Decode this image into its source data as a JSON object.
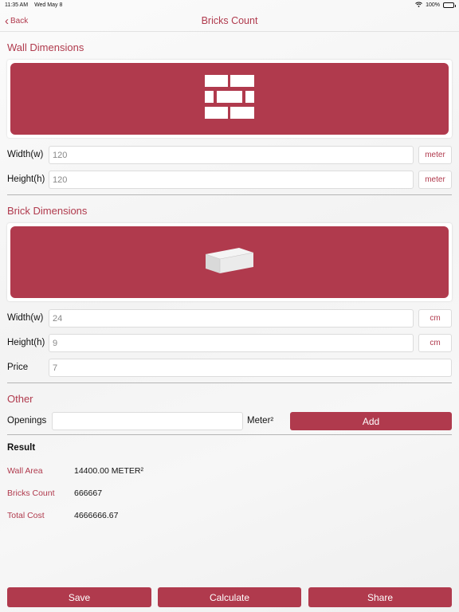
{
  "status": {
    "time": "11:35 AM",
    "date": "Wed May 8",
    "battery": "100%"
  },
  "nav": {
    "back_label": "Back",
    "title": "Bricks Count"
  },
  "wall": {
    "section_title": "Wall Dimensions",
    "width_label": "Width(w)",
    "width_value": "120",
    "width_unit": "meter",
    "height_label": "Height(h)",
    "height_value": "120",
    "height_unit": "meter"
  },
  "brick": {
    "section_title": "Brick Dimensions",
    "width_label": "Width(w)",
    "width_value": "24",
    "width_unit": "cm",
    "height_label": "Height(h)",
    "height_value": "9",
    "height_unit": "cm",
    "price_label": "Price",
    "price_value": "7"
  },
  "other": {
    "section_title": "Other",
    "openings_label": "Openings",
    "openings_value": "",
    "openings_unit": "Meter²",
    "add_label": "Add"
  },
  "result": {
    "title": "Result",
    "wall_area_label": "Wall Area",
    "wall_area_value": "14400.00 METER²",
    "bricks_count_label": "Bricks Count",
    "bricks_count_value": "666667",
    "total_cost_label": "Total Cost",
    "total_cost_value": "4666666.67"
  },
  "actions": {
    "save_label": "Save",
    "calculate_label": "Calculate",
    "share_label": "Share"
  },
  "colors": {
    "accent": "#b03a4d"
  }
}
